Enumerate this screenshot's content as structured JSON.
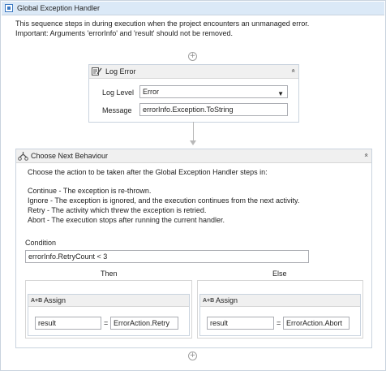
{
  "outer": {
    "title": "Global Exception Handler",
    "description_line1": "This sequence steps in during execution when the project encounters an unmanaged error.",
    "description_line2": "Important: Arguments 'errorInfo' and 'result' should not be removed."
  },
  "add_icon": "+",
  "log_error": {
    "title": "Log Error",
    "collapse_icon": "«",
    "log_level_label": "Log Level",
    "log_level_value": "Error",
    "dropdown_arrow": "▼",
    "message_label": "Message",
    "message_value": "errorInfo.Exception.ToString"
  },
  "choose": {
    "title": "Choose Next Behaviour",
    "collapse_icon": "«",
    "intro": "Choose the action to be taken after the Global Exception Handler steps in:",
    "options": [
      "Continue - The exception is re-thrown.",
      "Ignore - The exception is ignored, and the execution continues from the next activity.",
      "Retry - The activity which threw the exception is retried.",
      "Abort - The execution stops after running the current handler."
    ],
    "condition_label": "Condition",
    "condition_value": "errorInfo.RetryCount < 3",
    "then_label": "Then",
    "else_label": "Else"
  },
  "assign_then": {
    "title": "Assign",
    "icon_text": "A+B",
    "to": "result",
    "equals": "=",
    "value": "ErrorAction.Retry"
  },
  "assign_else": {
    "title": "Assign",
    "icon_text": "A+B",
    "to": "result",
    "equals": "=",
    "value": "ErrorAction.Abort"
  }
}
